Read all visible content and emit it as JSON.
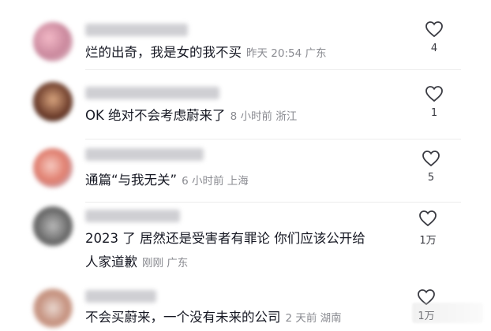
{
  "comments": [
    {
      "text": "烂的出奇，我是女的我不买",
      "meta": "昨天 20:54 广东",
      "likes": "4"
    },
    {
      "text": "OK 绝对不会考虑蔚来了",
      "meta": "8 小时前 浙江",
      "likes": "1"
    },
    {
      "text": "通篇“与我无关”",
      "meta": "6 小时前 上海",
      "likes": "5"
    },
    {
      "text_line1": "2023 了 居然还是受害者有罪论 你们应该公开给",
      "text_line2": "人家道歉",
      "meta": "刚刚 广东",
      "likes": "1万"
    },
    {
      "text": "不会买蔚来，一个没有未来的公司",
      "meta": "2 天前 湖南",
      "likes": "1万"
    }
  ]
}
